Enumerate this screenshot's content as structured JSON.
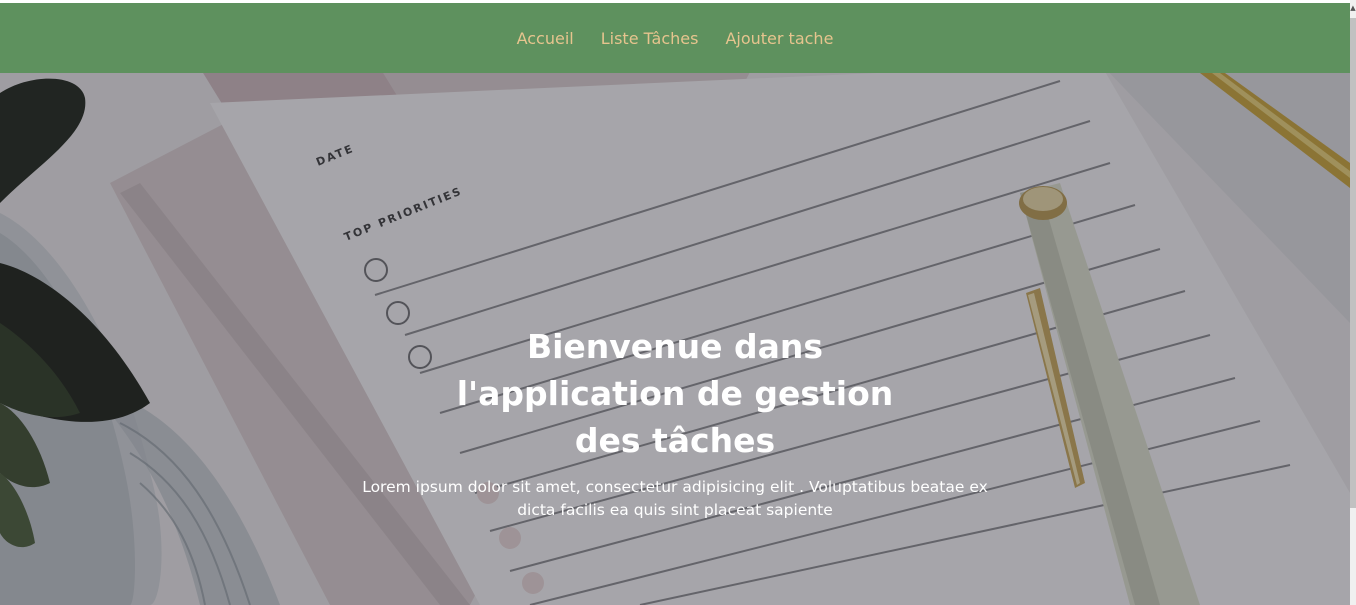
{
  "navbar": {
    "links": [
      {
        "label": "Accueil"
      },
      {
        "label": "Liste Tâches"
      },
      {
        "label": "Ajouter tache"
      }
    ],
    "background": "#5e915e",
    "link_color": "#e6c48e"
  },
  "hero": {
    "title": "Bienvenue dans l'application de gestion des tâches",
    "text": "Lorem ipsum dolor sit amet, consectetur adipisicing elit . Voluptatibus beatae ex dicta facilis ea quis sint placeat sapiente",
    "notepad_labels": {
      "date": "DATE",
      "priorities": "TOP PRIORITIES"
    }
  }
}
